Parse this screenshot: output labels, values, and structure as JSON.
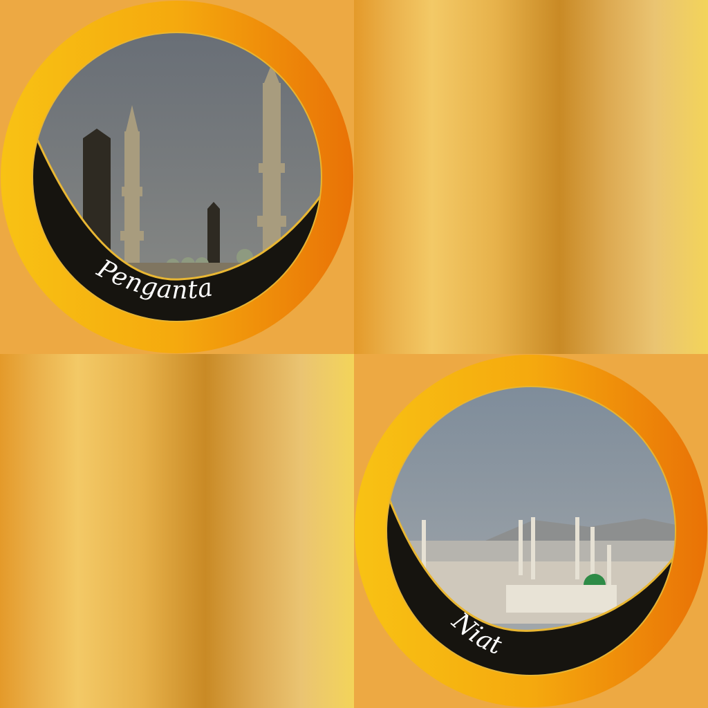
{
  "menu": {
    "items": [
      {
        "label": "Pengantar",
        "image": "mosque-minarets-evening-photo"
      },
      {
        "label": "Niat",
        "image": "mosque-green-dome-city-photo"
      }
    ]
  },
  "colors": {
    "ring_start": "#f8c214",
    "ring_end": "#e97206",
    "band": "#16140f",
    "background": "#eda943"
  }
}
